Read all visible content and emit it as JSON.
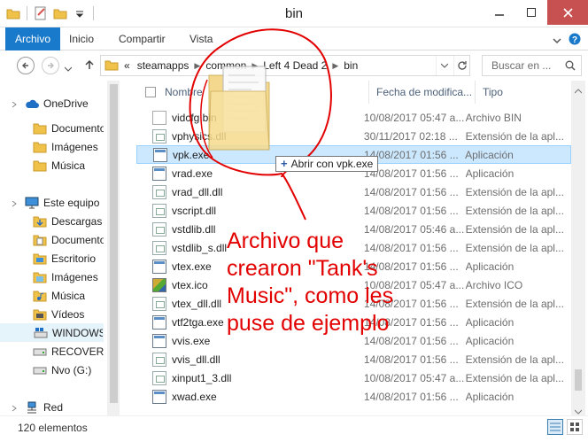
{
  "window": {
    "title": "bin"
  },
  "ribbon": {
    "tabs": [
      "Archivo",
      "Inicio",
      "Compartir",
      "Vista"
    ]
  },
  "address": {
    "prefix": "«",
    "crumbs": [
      "steamapps",
      "common",
      "Left 4 Dead 2",
      "bin"
    ]
  },
  "search": {
    "placeholder": "Buscar en ..."
  },
  "nav": {
    "items": [
      {
        "label": "OneDrive",
        "icon": "cloud-icon",
        "level": 0
      },
      {
        "label": "Documentos",
        "icon": "folder-icon",
        "level": 1
      },
      {
        "label": "Imágenes",
        "icon": "folder-icon",
        "level": 1
      },
      {
        "label": "Música",
        "icon": "folder-icon",
        "level": 1
      },
      {
        "label": "Este equipo",
        "icon": "computer-icon",
        "level": 0
      },
      {
        "label": "Descargas",
        "icon": "downloads-icon",
        "level": 1
      },
      {
        "label": "Documentos",
        "icon": "documents-icon",
        "level": 1
      },
      {
        "label": "Escritorio",
        "icon": "desktop-icon",
        "level": 1
      },
      {
        "label": "Imágenes",
        "icon": "pictures-icon",
        "level": 1
      },
      {
        "label": "Música",
        "icon": "music-icon",
        "level": 1
      },
      {
        "label": "Vídeos",
        "icon": "videos-icon",
        "level": 1
      },
      {
        "label": "WINDOWS",
        "icon": "windows-drive-icon",
        "level": 1
      },
      {
        "label": "RECOVERY",
        "icon": "drive-icon",
        "level": 1
      },
      {
        "label": "Nvo (G:)",
        "icon": "drive-icon",
        "level": 1
      },
      {
        "label": "Red",
        "icon": "network-icon",
        "level": 0
      }
    ]
  },
  "columns": {
    "name": "Nombre",
    "date": "Fecha de modifica...",
    "type": "Tipo"
  },
  "files": [
    {
      "name": "vidcfg.bin",
      "date": "10/08/2017 05:47 a...",
      "type": "Archivo BIN",
      "kind": "bin"
    },
    {
      "name": "vphysics.dll",
      "date": "30/11/2017 02:18 ...",
      "type": "Extensión de la apl...",
      "kind": "dll"
    },
    {
      "name": "vpk.exe",
      "date": "14/08/2017 01:56 ...",
      "type": "Aplicación",
      "kind": "exe"
    },
    {
      "name": "vrad.exe",
      "date": "14/08/2017 01:56 ...",
      "type": "Aplicación",
      "kind": "exe"
    },
    {
      "name": "vrad_dll.dll",
      "date": "14/08/2017 01:56 ...",
      "type": "Extensión de la apl...",
      "kind": "dll"
    },
    {
      "name": "vscript.dll",
      "date": "14/08/2017 01:56 ...",
      "type": "Extensión de la apl...",
      "kind": "dll"
    },
    {
      "name": "vstdlib.dll",
      "date": "14/08/2017 05:46 a...",
      "type": "Extensión de la apl...",
      "kind": "dll"
    },
    {
      "name": "vstdlib_s.dll",
      "date": "14/08/2017 01:56 ...",
      "type": "Extensión de la apl...",
      "kind": "dll"
    },
    {
      "name": "vtex.exe",
      "date": "14/08/2017 01:56 ...",
      "type": "Aplicación",
      "kind": "exe"
    },
    {
      "name": "vtex.ico",
      "date": "10/08/2017 05:47 a...",
      "type": "Archivo ICO",
      "kind": "ico"
    },
    {
      "name": "vtex_dll.dll",
      "date": "14/08/2017 01:56 ...",
      "type": "Extensión de la apl...",
      "kind": "dll"
    },
    {
      "name": "vtf2tga.exe",
      "date": "14/08/2017 01:56 ...",
      "type": "Aplicación",
      "kind": "exe"
    },
    {
      "name": "vvis.exe",
      "date": "14/08/2017 01:56 ...",
      "type": "Aplicación",
      "kind": "exe"
    },
    {
      "name": "vvis_dll.dll",
      "date": "14/08/2017 01:56 ...",
      "type": "Extensión de la apl...",
      "kind": "dll"
    },
    {
      "name": "xinput1_3.dll",
      "date": "10/08/2017 05:47 a...",
      "type": "Extensión de la apl...",
      "kind": "dll"
    },
    {
      "name": "xwad.exe",
      "date": "14/08/2017 01:56 ...",
      "type": "Aplicación",
      "kind": "exe"
    }
  ],
  "status": {
    "count": "120 elementos"
  },
  "drag": {
    "tooltip": "Abrir con vpk.exe"
  },
  "annotation": {
    "text": "Archivo que crearon \"Tank's Music\", como les puse de ejemplo",
    "color": "#e20000"
  },
  "colors": {
    "accent": "#1979ca",
    "selection": "#cce8ff",
    "close": "#c75050"
  }
}
